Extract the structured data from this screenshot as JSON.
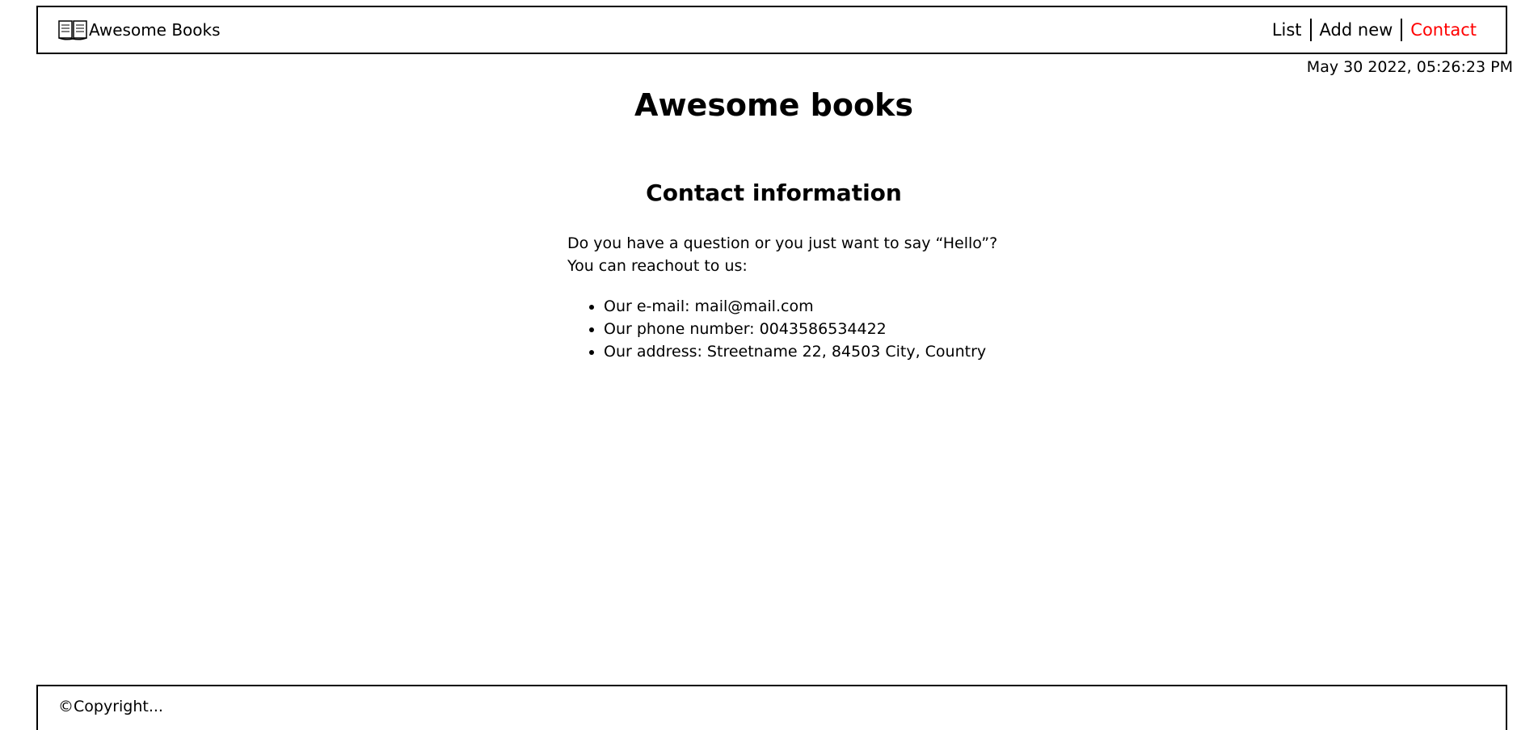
{
  "header": {
    "brand": "Awesome Books",
    "brand_icon": "open-book-icon",
    "nav": [
      {
        "label": "List"
      },
      {
        "label": "Add new"
      },
      {
        "label": "Contact",
        "active": true
      }
    ],
    "active_color": "#ff0000"
  },
  "datetime": "May 30 2022, 05:26:23 PM",
  "main": {
    "title": "Awesome books",
    "section_title": "Contact information",
    "intro_line1": "Do you have a question or you just want to say “Hello”?",
    "intro_line2": "You can reachout to us:",
    "items": [
      "Our e-mail: mail@mail.com",
      "Our phone number: 0043586534422",
      "Our address: Streetname 22, 84503 City, Country"
    ]
  },
  "footer": {
    "text": "©Copyright..."
  }
}
